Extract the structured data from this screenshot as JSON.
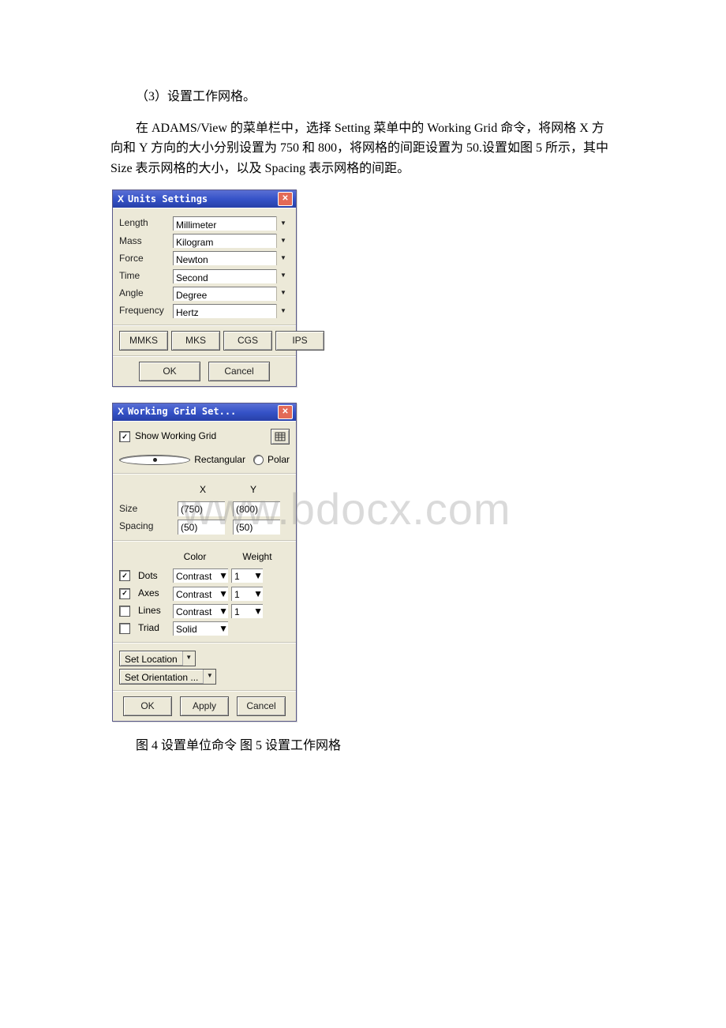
{
  "paragraphs": {
    "p1": "（3）设置工作网格。",
    "p2": "在 ADAMS/View 的菜单栏中，选择 Setting 菜单中的 Working Grid 命令，将网格 X 方向和 Y 方向的大小分别设置为 750 和 800，将网格的间距设置为 50.设置如图 5 所示，其中 Size 表示网格的大小，以及 Spacing 表示网格的间距。"
  },
  "units_dialog": {
    "title": "Units Settings",
    "rows": {
      "length": {
        "label": "Length",
        "value": "Millimeter"
      },
      "mass": {
        "label": "Mass",
        "value": "Kilogram"
      },
      "force": {
        "label": "Force",
        "value": "Newton"
      },
      "time": {
        "label": "Time",
        "value": "Second"
      },
      "angle": {
        "label": "Angle",
        "value": "Degree"
      },
      "frequency": {
        "label": "Frequency",
        "value": "Hertz"
      }
    },
    "preset_buttons": {
      "mmks": "MMKS",
      "mks": "MKS",
      "cgs": "CGS",
      "ips": "IPS"
    },
    "ok": "OK",
    "cancel": "Cancel"
  },
  "grid_dialog": {
    "title": "Working Grid Set...",
    "show_grid": "Show Working Grid",
    "coord": {
      "rect": "Rectangular",
      "polar": "Polar"
    },
    "headers": {
      "x": "X",
      "y": "Y"
    },
    "size": {
      "label": "Size",
      "x": "(750)",
      "y": "(800)"
    },
    "spacing": {
      "label": "Spacing",
      "x": "(50)",
      "y": "(50)"
    },
    "col_headers": {
      "color": "Color",
      "weight": "Weight"
    },
    "dots": {
      "label": "Dots",
      "color": "Contrast",
      "weight": "1"
    },
    "axes": {
      "label": "Axes",
      "color": "Contrast",
      "weight": "1"
    },
    "lines": {
      "label": "Lines",
      "color": "Contrast",
      "weight": "1"
    },
    "triad": {
      "label": "Triad",
      "value": "Solid"
    },
    "set_location": "Set Location",
    "set_orientation": "Set Orientation ...",
    "ok": "OK",
    "apply": "Apply",
    "cancel": "Cancel"
  },
  "caption": "图 4 设置单位命令 图 5 设置工作网格",
  "watermark": "www.bdocx.com"
}
